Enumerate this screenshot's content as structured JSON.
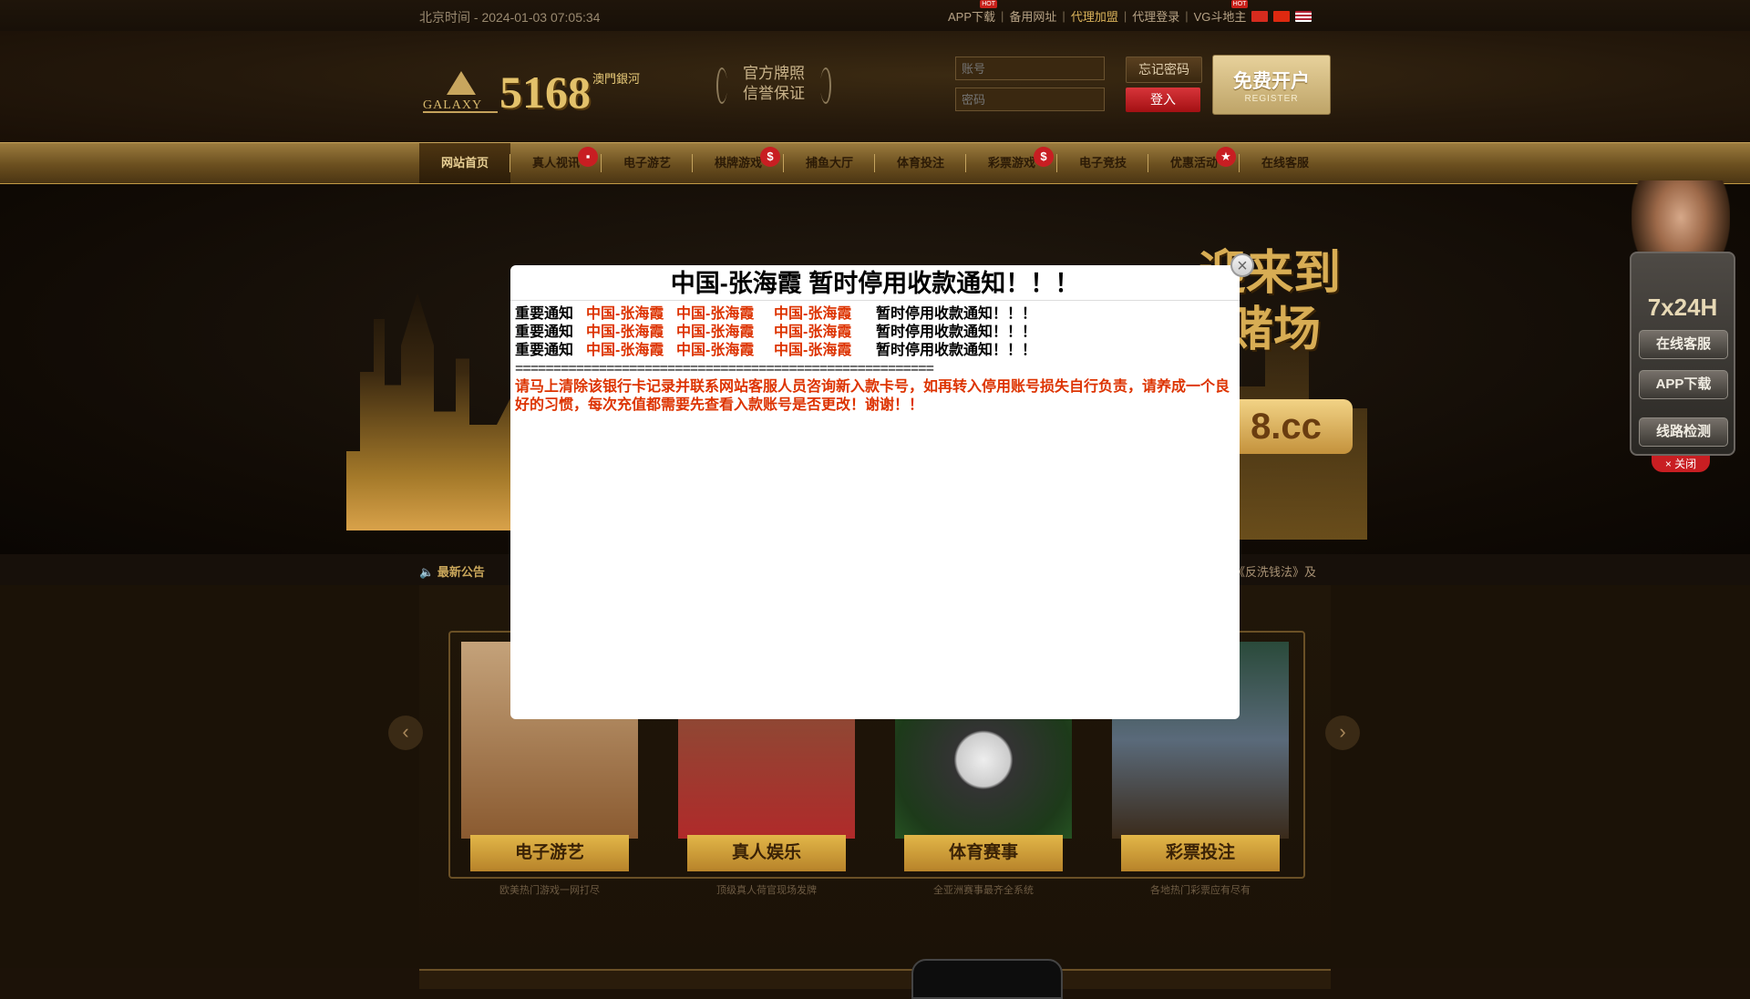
{
  "topbar": {
    "time": "北京时间 - 2024-01-03 07:05:34",
    "links": [
      "APP下载",
      "备用网址",
      "代理加盟",
      "代理登录",
      "VG斗地主"
    ],
    "flags": [
      "cn",
      "hk",
      "us"
    ]
  },
  "header": {
    "logo_num": "5168",
    "logo_galaxy": "GALAXY",
    "logo_sub": "澳門銀河",
    "badge_line1": "官方牌照",
    "badge_line2": "信誉保证",
    "account_placeholder": "账号",
    "password_placeholder": "密码",
    "forgot_label": "忘记密码",
    "login_label": "登入",
    "register_label": "免费开户",
    "register_sub": "REGISTER"
  },
  "nav": {
    "items": [
      "网站首页",
      "真人视讯",
      "电子游艺",
      "棋牌游戏",
      "捕鱼大厅",
      "体育投注",
      "彩票游戏",
      "电子竞技",
      "优惠活动",
      "在线客服"
    ]
  },
  "banner": {
    "welcome_line1": "迎来到",
    "welcome_line2": "赌场",
    "domain_text": "8.cc"
  },
  "notice": {
    "label": "最新公告",
    "scroll": "东《反洗钱法》及"
  },
  "cards": [
    {
      "title": "电子游艺",
      "desc": "欧美热门游戏一网打尽",
      "color": "#b58a52"
    },
    {
      "title": "真人娱乐",
      "desc": "顶级真人荷官现场发牌",
      "color": "#a32a2a"
    },
    {
      "title": "体育赛事",
      "desc": "全亚洲赛事最齐全系统",
      "color": "#2e5a2a"
    },
    {
      "title": "彩票投注",
      "desc": "各地热门彩票应有尽有",
      "color": "#3a4e66"
    }
  ],
  "side": {
    "hours": "7x24H",
    "service": "在线客服",
    "app": "APP下载",
    "check": "线路检测",
    "close": "× 关闭"
  },
  "popup": {
    "title": "中国-张海霞 暂时停用收款通知！！！",
    "rows": [
      {
        "c1": "重要通知",
        "c2": "中国-张海霞",
        "c3": "中国-张海霞",
        "c4": "中国-张海霞",
        "c5": "暂时停用收款通知！！！"
      },
      {
        "c1": "重要通知",
        "c2": "中国-张海霞",
        "c3": "中国-张海霞",
        "c4": "中国-张海霞",
        "c5": "暂时停用收款通知！！！"
      },
      {
        "c1": "重要通知",
        "c2": "中国-张海霞",
        "c3": "中国-张海霞",
        "c4": "中国-张海霞",
        "c5": "暂时停用收款通知！！！"
      }
    ],
    "divider": "=======================================================",
    "message": "请马上清除该银行卡记录并联系网站客服人员咨询新入款卡号，如再转入停用账号损失自行负责，请养成一个良好的习惯，每次充值都需要先查看入款账号是否更改！谢谢！！",
    "close": "×"
  }
}
